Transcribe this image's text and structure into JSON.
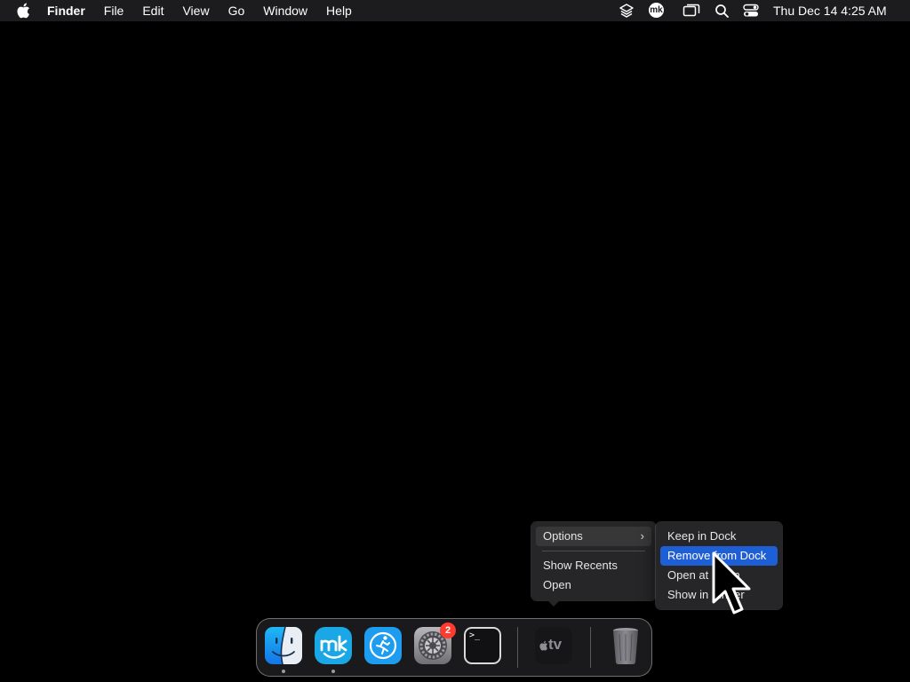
{
  "menubar": {
    "app_name": "Finder",
    "menus": [
      "File",
      "Edit",
      "View",
      "Go",
      "Window",
      "Help"
    ],
    "status_icons": [
      "layers-icon",
      "mk-icon",
      "screen-mirror-icon",
      "search-icon",
      "control-center-icon"
    ],
    "mk_label": "mk",
    "clock": "Thu Dec 14  4:25 AM"
  },
  "context_menu": {
    "options_label": "Options",
    "show_recents_label": "Show Recents",
    "open_label": "Open"
  },
  "options_submenu": {
    "keep_in_dock": "Keep in Dock",
    "remove_from_dock": "Remove from Dock",
    "open_at_login": "Open at Login",
    "show_in_finder": "Show in Finder",
    "selected": "Remove from Dock"
  },
  "dock": {
    "items": [
      {
        "icon": "finder-icon",
        "running": true
      },
      {
        "icon": "mk-app-icon",
        "running": true
      },
      {
        "icon": "fitness-app-icon",
        "running": false
      },
      {
        "icon": "system-settings-icon",
        "running": false,
        "badge": "2"
      },
      {
        "icon": "terminal-icon",
        "running": false
      },
      {
        "icon": "apple-tv-icon",
        "running": false
      },
      {
        "icon": "trash-icon",
        "running": false
      }
    ],
    "settings_badge": "2",
    "terminal_prompt": ">_",
    "tv_label": "tv"
  },
  "colors": {
    "menubar_bg": "#1c1c1e",
    "desktop_bg": "#000000",
    "menu_selection": "#1f5fd6",
    "badge_red": "#ff3b30"
  }
}
